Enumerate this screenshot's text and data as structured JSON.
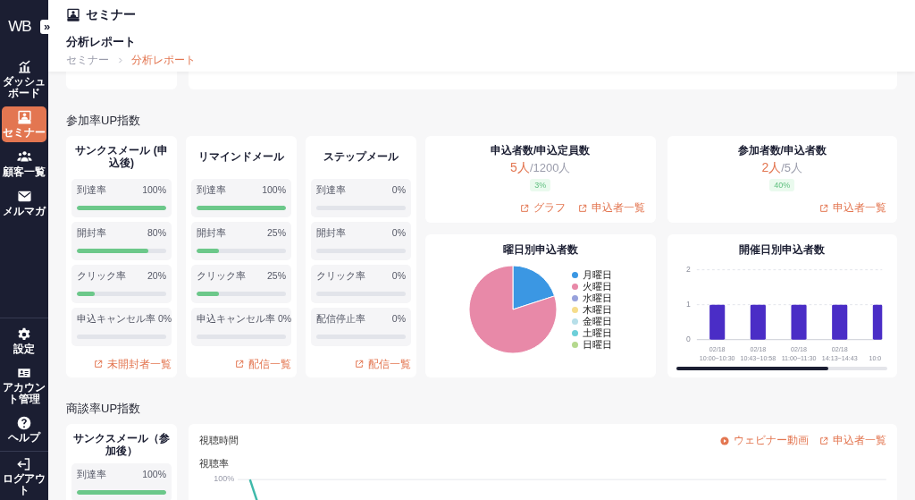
{
  "sidebar": {
    "logo": "WB",
    "toggle": "»",
    "items": [
      {
        "label": "ダッシュボード",
        "selected": false
      },
      {
        "label": "セミナー",
        "selected": true
      },
      {
        "label": "顧客一覧",
        "selected": false
      },
      {
        "label": "メルマガ",
        "selected": false
      }
    ],
    "bottom_items": [
      {
        "label": "設定"
      },
      {
        "label": "アカウント管理"
      },
      {
        "label": "ヘルプ"
      }
    ],
    "logout": {
      "label": "ログアウト"
    }
  },
  "header": {
    "title": "セミナー",
    "subtitle": "分析レポート",
    "breadcrumb": [
      {
        "label": "セミナー",
        "current": false
      },
      {
        "label": "分析レポート",
        "current": true
      }
    ]
  },
  "participation": {
    "title": "参加率UP指数",
    "mail_cards": [
      {
        "title": "サンクスメール (申込後)",
        "metrics": [
          {
            "label": "到達率",
            "value": "100%",
            "level": 1
          },
          {
            "label": "開封率",
            "value": "80%",
            "level": 0.8
          },
          {
            "label": "クリック率",
            "value": "20%",
            "level": 0.2
          },
          {
            "label": "申込キャンセル率",
            "value": "0%",
            "level": 0
          }
        ],
        "link": "未開封者一覧"
      },
      {
        "title": "リマインドメール",
        "metrics": [
          {
            "label": "到達率",
            "value": "100%",
            "level": 1
          },
          {
            "label": "開封率",
            "value": "25%",
            "level": 0.25
          },
          {
            "label": "クリック率",
            "value": "25%",
            "level": 0.25
          },
          {
            "label": "申込キャンセル率",
            "value": "0%",
            "level": 0
          }
        ],
        "link": "配信一覧"
      },
      {
        "title": "ステップメール",
        "metrics": [
          {
            "label": "到達率",
            "value": "0%",
            "level": 0
          },
          {
            "label": "開封率",
            "value": "0%",
            "level": 0
          },
          {
            "label": "クリック率",
            "value": "0%",
            "level": 0
          },
          {
            "label": "配信停止率",
            "value": "0%",
            "level": 0
          }
        ],
        "link": "配信一覧"
      }
    ],
    "ratio_cards": [
      {
        "title": "申込者数/申込定員数",
        "count": "5人",
        "total": "/1200人",
        "rate": "3%",
        "links": [
          "グラフ",
          "申込者一覧"
        ]
      },
      {
        "title": "参加者数/申込者数",
        "count": "2人",
        "total": "/5人",
        "rate": "40%",
        "links": [
          "申込者一覧"
        ]
      }
    ],
    "weekday_chart": {
      "chart_data": {
        "type": "pie",
        "title": "曜日別申込者数",
        "categories": [
          "月曜日",
          "火曜日",
          "水曜日",
          "木曜日",
          "金曜日",
          "土曜日",
          "日曜日"
        ],
        "values": [
          20,
          80,
          0,
          0,
          0,
          0,
          0
        ],
        "legend": "right",
        "colors": [
          "#3b97e3",
          "#e889a8",
          "#98a2dc",
          "#f6dd8c",
          "#b7dfe9",
          "#6dcfd9",
          "#b5d98e"
        ]
      }
    },
    "session_chart": {
      "chart_data": {
        "type": "bar",
        "title": "開催日別申込者数",
        "categories": [
          "02/18 10:00~10:30",
          "02/18 10:43~10:58",
          "02/18 11:00~11:30",
          "02/18 14:13~14:43",
          "10:0"
        ],
        "values": [
          1,
          1,
          1,
          1,
          1
        ],
        "ylim": [
          0,
          2
        ],
        "yticks": [
          0,
          1,
          2
        ]
      }
    }
  },
  "deal": {
    "title": "商談率UP指数",
    "mail_card": {
      "title": "サンクスメール（参加後）",
      "metrics": [
        {
          "label": "到達率",
          "value": "100%",
          "level": 1
        }
      ]
    },
    "viewing_card": {
      "title": "視聴時間",
      "links": [
        {
          "kind": "video",
          "label": "ウェビナー動画"
        },
        {
          "kind": "external",
          "label": "申込者一覧"
        }
      ],
      "axis_label": "視聴率",
      "tick": "100%"
    }
  }
}
